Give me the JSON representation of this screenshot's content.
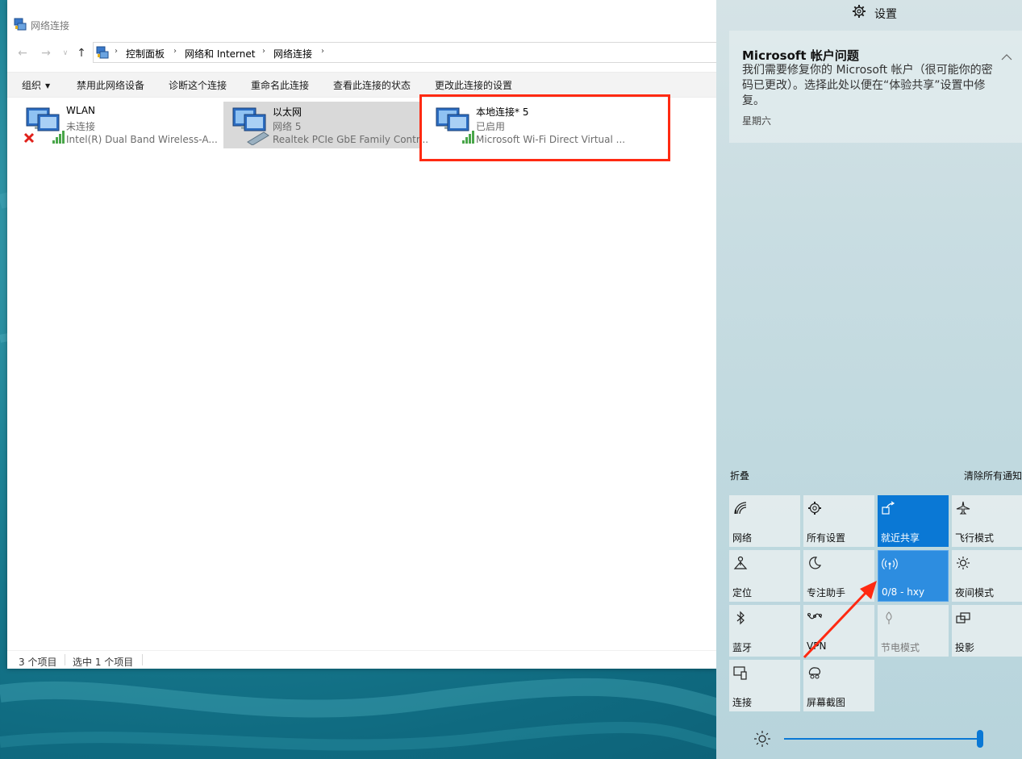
{
  "window": {
    "title": "网络连接",
    "breadcrumbs": [
      "控制面板",
      "网络和 Internet",
      "网络连接"
    ]
  },
  "commands": {
    "organize": "组织",
    "disable": "禁用此网络设备",
    "diagnose": "诊断这个连接",
    "rename": "重命名此连接",
    "view_status": "查看此连接的状态",
    "change_settings": "更改此连接的设置"
  },
  "connections": [
    {
      "name": "WLAN",
      "status": "未连接",
      "device": "Intel(R) Dual Band Wireless-A..."
    },
    {
      "name": "以太网",
      "status": "网络 5",
      "device": "Realtek PCIe GbE Family Contr..."
    },
    {
      "name": "本地连接* 5",
      "status": "已启用",
      "device": "Microsoft Wi-Fi Direct Virtual ..."
    }
  ],
  "statusbar": {
    "count": "3 个项目",
    "selected": "选中 1 个项目"
  },
  "action_center": {
    "header": "设置",
    "notification": {
      "title": "Microsoft 帐户问题",
      "body": "我们需要修复你的 Microsoft 帐户（很可能你的密码已更改）。选择此处以便在“体验共享”设置中修复。",
      "time": "星期六"
    },
    "collapse": "折叠",
    "clear_all": "清除所有通知",
    "tiles": {
      "network": "网络",
      "all_settings": "所有设置",
      "nearby_share": "就近共享",
      "airplane": "飞行模式",
      "location": "定位",
      "focus": "专注助手",
      "hotspot": "0/8 - hxy",
      "night": "夜间模式",
      "bluetooth": "蓝牙",
      "vpn": "VPN",
      "battery_saver": "节电模式",
      "project": "投影",
      "connect": "连接",
      "snip": "屏幕截图"
    },
    "brightness_level": 1.0
  },
  "colors": {
    "accent": "#0a78d5",
    "highlight": "#ff2a12",
    "selected_item": "#d9d9d9"
  }
}
